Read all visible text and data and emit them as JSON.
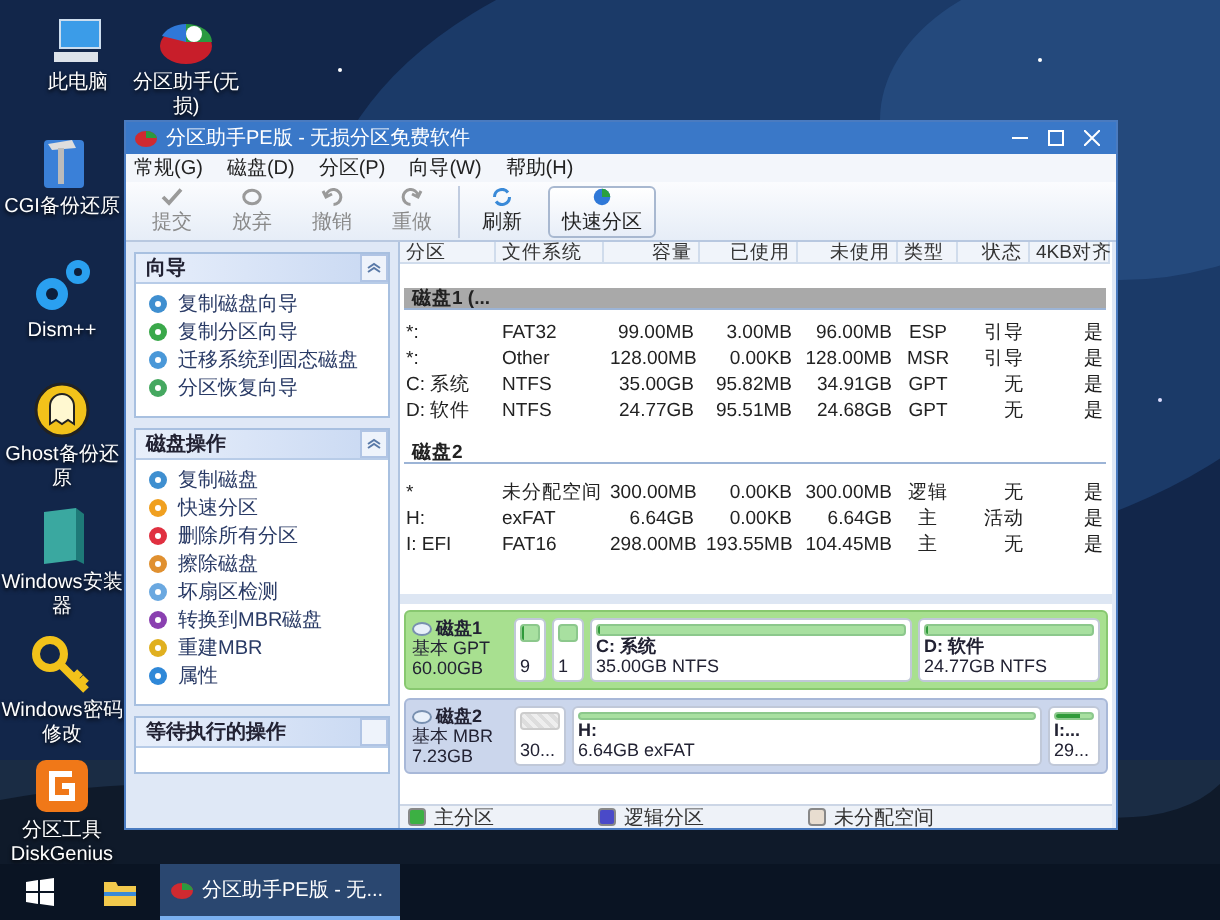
{
  "desktop_icons": [
    {
      "label": "此电脑",
      "kind": "computer"
    },
    {
      "label": "分区助手(无损)",
      "kind": "pie"
    },
    {
      "label": "CGI备份还原",
      "kind": "hammer"
    },
    {
      "label": "Dism++",
      "kind": "gear"
    },
    {
      "label": "Ghost备份还原",
      "kind": "ghost"
    },
    {
      "label": "Windows安装器",
      "kind": "installer"
    },
    {
      "label": "Windows密码修改",
      "kind": "key"
    },
    {
      "label": "分区工具DiskGenius",
      "kind": "diskgenius"
    }
  ],
  "window": {
    "title": "分区助手PE版 - 无损分区免费软件",
    "menu": [
      "常规(G)",
      "磁盘(D)",
      "分区(P)",
      "向导(W)",
      "帮助(H)"
    ],
    "toolbar": [
      [
        {
          "label": "提交",
          "kind": "check",
          "disabled": true,
          "boxed": false
        },
        {
          "label": "放弃",
          "kind": "discard",
          "disabled": true,
          "boxed": false
        },
        {
          "label": "撤销",
          "kind": "undo",
          "disabled": true,
          "boxed": false
        },
        {
          "label": "重做",
          "kind": "redo",
          "disabled": true,
          "boxed": false
        }
      ],
      [
        {
          "label": "刷新",
          "kind": "refresh",
          "disabled": false,
          "boxed": false
        },
        {
          "label": "快速分区",
          "kind": "quick",
          "disabled": false,
          "boxed": true
        }
      ]
    ],
    "sidebar": [
      {
        "title": "向导",
        "collapsible": true,
        "items": [
          {
            "label": "复制磁盘向导",
            "color": "#3f8fd0"
          },
          {
            "label": "复制分区向导",
            "color": "#3aa84a"
          },
          {
            "label": "迁移系统到固态磁盘",
            "color": "#4a98d8"
          },
          {
            "label": "分区恢复向导",
            "color": "#45a860"
          }
        ]
      },
      {
        "title": "磁盘操作",
        "collapsible": true,
        "items": [
          {
            "label": "复制磁盘",
            "color": "#3f8fd0"
          },
          {
            "label": "快速分区",
            "color": "#f0a020"
          },
          {
            "label": "删除所有分区",
            "color": "#e03040"
          },
          {
            "label": "擦除磁盘",
            "color": "#e09030"
          },
          {
            "label": "坏扇区检测",
            "color": "#6aa8e0"
          },
          {
            "label": "转换到MBR磁盘",
            "color": "#8a40b0"
          },
          {
            "label": "重建MBR",
            "color": "#e0b020"
          },
          {
            "label": "属性",
            "color": "#2f88d8"
          }
        ]
      },
      {
        "title": "等待执行的操作",
        "collapsible": false
      }
    ],
    "table": {
      "columns": [
        "分区",
        "文件系统",
        "容量",
        "已使用",
        "未使用",
        "类型",
        "状态",
        "4KB对齐"
      ],
      "groups": [
        {
          "title": "磁盘1 (...",
          "selected": true,
          "rows": [
            [
              "*:",
              "FAT32",
              "99.00MB",
              "3.00MB",
              "96.00MB",
              "ESP",
              "引导",
              "是"
            ],
            [
              "*:",
              "Other",
              "128.00MB",
              "0.00KB",
              "128.00MB",
              "MSR",
              "引导",
              "是"
            ],
            [
              "C: 系统",
              "NTFS",
              "35.00GB",
              "95.82MB",
              "34.91GB",
              "GPT",
              "无",
              "是"
            ],
            [
              "D: 软件",
              "NTFS",
              "24.77GB",
              "95.51MB",
              "24.68GB",
              "GPT",
              "无",
              "是"
            ]
          ]
        },
        {
          "title": "磁盘2",
          "selected": false,
          "rows": [
            [
              "*",
              "未分配空间",
              "300.00MB",
              "0.00KB",
              "300.00MB",
              "逻辑",
              "无",
              "是"
            ],
            [
              "H:",
              "exFAT",
              "6.64GB",
              "0.00KB",
              "6.64GB",
              "主",
              "活动",
              "是"
            ],
            [
              "I: EFI",
              "FAT16",
              "298.00MB",
              "193.55MB",
              "104.45MB",
              "主",
              "无",
              "是"
            ]
          ]
        }
      ]
    },
    "disks": [
      {
        "name": "磁盘1",
        "type": "基本 GPT",
        "size": "60.00GB",
        "selected": true,
        "partitions": [
          {
            "detail": "9",
            "kind": "primary",
            "level": 0.03
          },
          {
            "detail": "1",
            "kind": "primary",
            "level": 0
          },
          {
            "label": "C: 系统",
            "detail": "35.00GB NTFS",
            "kind": "primary",
            "level": 0.003
          },
          {
            "label": "D: 软件",
            "detail": "24.77GB NTFS",
            "kind": "primary",
            "level": 0.004
          }
        ]
      },
      {
        "name": "磁盘2",
        "type": "基本 MBR",
        "size": "7.23GB",
        "selected": false,
        "partitions": [
          {
            "detail": "30...",
            "kind": "unallocated",
            "level": 0
          },
          {
            "label": "H:",
            "detail": "6.64GB exFAT",
            "kind": "primary",
            "level": 0
          },
          {
            "label": "I:...",
            "detail": "29...",
            "kind": "primary",
            "level": 0.65
          }
        ]
      }
    ],
    "legend": [
      {
        "label": "主分区",
        "color": "#3cb043"
      },
      {
        "label": "逻辑分区",
        "color": "#4a4ac8"
      },
      {
        "label": "未分配空间",
        "color": "#e8ddd0"
      }
    ]
  },
  "taskbar": {
    "tasks": [
      {
        "label": "分区助手PE版 - 无...",
        "selected": true
      }
    ]
  }
}
